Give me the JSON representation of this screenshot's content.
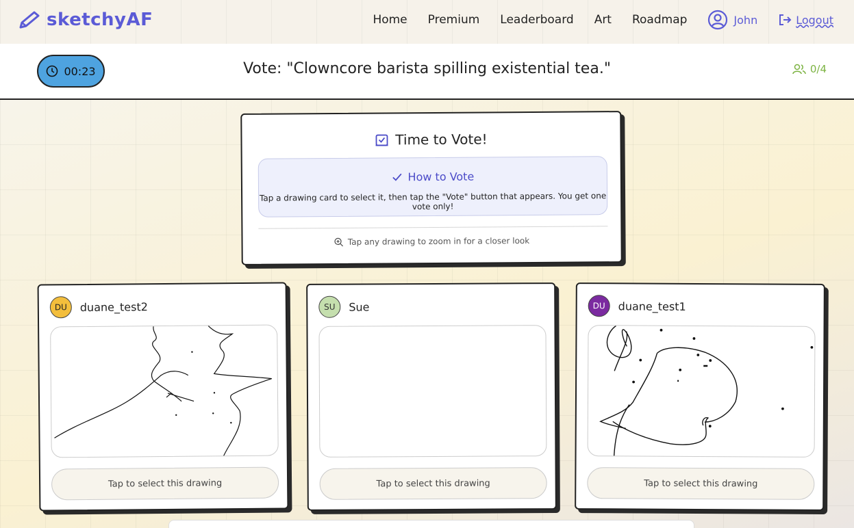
{
  "nav": {
    "brand": "sketchyAF",
    "links": [
      {
        "label": "Home"
      },
      {
        "label": "Premium"
      },
      {
        "label": "Leaderboard"
      },
      {
        "label": "Art"
      },
      {
        "label": "Roadmap"
      }
    ],
    "user_name": "John",
    "logout_label": "Logout"
  },
  "status": {
    "timer": "00:23",
    "vote_title": "Vote: \"Clowncore barista spilling existential tea.\"",
    "players": "0/4"
  },
  "info": {
    "title": "Time to Vote!",
    "howto_title": "How to Vote",
    "howto_text": "Tap a drawing card to select it, then tap the \"Vote\" button that appears. You get one vote only!",
    "zoom_hint": "Tap any drawing to zoom in for a closer look"
  },
  "drawings": [
    {
      "initials": "DU",
      "author": "duane_test2",
      "avatar_color": "#f3be3c",
      "select_label": "Tap to select this drawing"
    },
    {
      "initials": "SU",
      "author": "Sue",
      "avatar_color": "#c5dfae",
      "select_label": "Tap to select this drawing"
    },
    {
      "initials": "DU",
      "author": "duane_test1",
      "avatar_color": "#7b2aa0",
      "select_label": "Tap to select this drawing"
    }
  ],
  "colors": {
    "brand": "#5b5bd6",
    "timer_bg": "#4ea3e0",
    "players": "#7cb342",
    "howto_bg": "#eef0fc"
  }
}
